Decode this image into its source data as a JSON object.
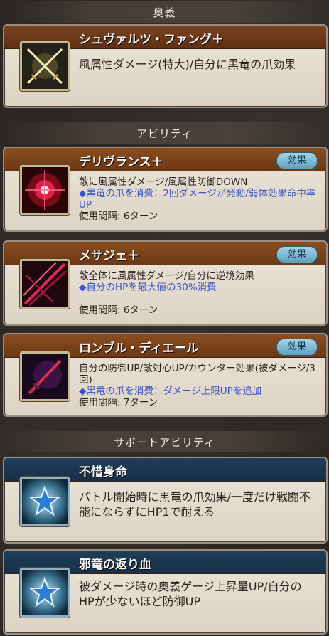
{
  "sections": {
    "ougi": "奥義",
    "ability": "アビリティ",
    "support": "サポートアビリティ"
  },
  "ougi": {
    "title": "シュヴァルツ・ファング＋",
    "desc": "風属性ダメージ(特大)/自分に黒竜の爪効果",
    "icon": "crossed-swords-icon"
  },
  "abilities": [
    {
      "title": "デリヴランス＋",
      "button": "効果",
      "desc": "敵に風属性ダメージ/風属性防御DOWN",
      "note": "◆黒竜の爪を消費：2回ダメージが発動/弱体効果命中率UP",
      "interval": "使用間隔: 6ターン",
      "icon": "red-burst-icon"
    },
    {
      "title": "メサジェ＋",
      "button": "効果",
      "desc": "敵全体に風属性ダメージ/自分に逆境効果",
      "note": "◆自分のHPを最大値の30%消費",
      "interval": "使用間隔: 6ターン",
      "icon": "red-slash-icon"
    },
    {
      "title": "ロンブル・ディエール",
      "button": "効果",
      "desc": "自分の防御UP/敵対心UP/カウンター効果(被ダメージ/3回)",
      "note": "◆黒竜の爪を消費：ダメージ上限UPを追加",
      "interval": "使用間隔: 7ターン",
      "icon": "dark-sword-icon"
    }
  ],
  "supports": [
    {
      "title": "不惜身命",
      "desc": "バトル開始時に黒竜の爪効果/一度だけ戦闘不能にならずにHP1で耐える",
      "icon": "star-icon"
    },
    {
      "title": "邪竜の返り血",
      "desc": "被ダメージ時の奥義ゲージ上昇量UP/自分のHPが少ないほど防御UP",
      "icon": "star-icon"
    }
  ]
}
